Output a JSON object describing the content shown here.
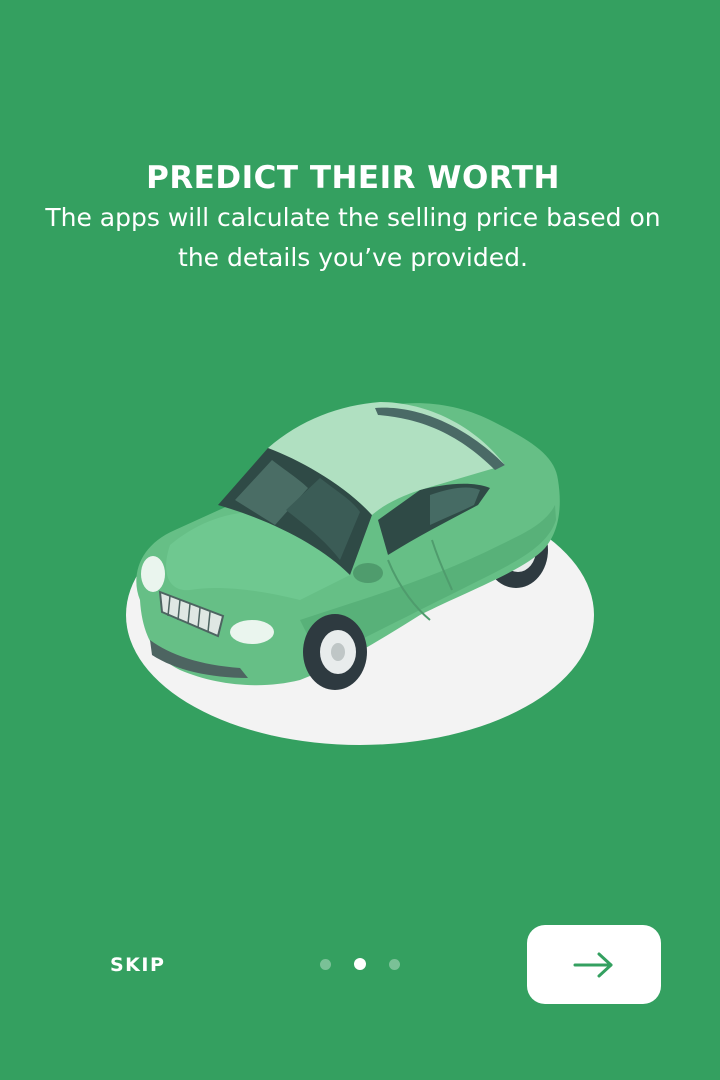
{
  "onboarding": {
    "title": "PREDICT THEIR WORTH",
    "description": "The apps will calculate the selling price based on the details you’ve provided.",
    "skip_label": "SKIP",
    "pagination": {
      "total": 3,
      "active_index": 1
    },
    "next_button_icon": "arrow-right-icon"
  },
  "colors": {
    "background": "#34a060",
    "accent": "#34a060",
    "button_bg": "#ffffff",
    "car_body": "#66bf86",
    "car_roof": "#b0e0c1",
    "shadow_disc": "#f3f3f3"
  }
}
